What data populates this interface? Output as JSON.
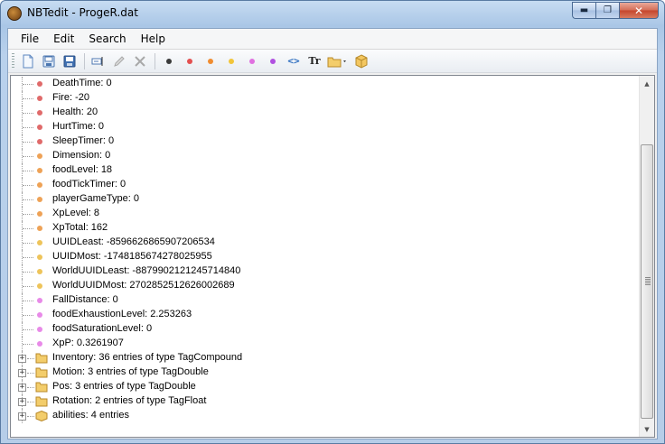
{
  "window": {
    "title": "NBTedit - ProgeR.dat"
  },
  "caption": {
    "minimize": "▬",
    "maximize": "❐",
    "close": "✕"
  },
  "menu": [
    {
      "label": "File"
    },
    {
      "label": "Edit"
    },
    {
      "label": "Search"
    },
    {
      "label": "Help"
    }
  ],
  "toolbar": {
    "icons": [
      "new-file-icon",
      "open-file-icon",
      "save-icon",
      "rename-icon",
      "edit-value-icon",
      "delete-icon"
    ],
    "tag_dots": [
      {
        "name": "byte-tag-icon",
        "color": "#3a3a3a"
      },
      {
        "name": "short-tag-icon",
        "color": "#e35050"
      },
      {
        "name": "int-tag-icon",
        "color": "#f08c30"
      },
      {
        "name": "long-tag-icon",
        "color": "#f2c53a"
      },
      {
        "name": "float-tag-icon",
        "color": "#e070e0"
      },
      {
        "name": "double-tag-icon",
        "color": "#b050e0"
      }
    ],
    "array_label": "<>",
    "string_label": "Tr"
  },
  "tree": {
    "rows": [
      {
        "label": "DeathTime: 0",
        "kind": "short",
        "color": "#e06a6a"
      },
      {
        "label": "Fire: -20",
        "kind": "short",
        "color": "#e06a6a"
      },
      {
        "label": "Health: 20",
        "kind": "short",
        "color": "#e06a6a"
      },
      {
        "label": "HurtTime: 0",
        "kind": "short",
        "color": "#e06a6a"
      },
      {
        "label": "SleepTimer: 0",
        "kind": "short",
        "color": "#e06a6a"
      },
      {
        "label": "Dimension: 0",
        "kind": "int",
        "color": "#eea256"
      },
      {
        "label": "foodLevel: 18",
        "kind": "int",
        "color": "#eea256"
      },
      {
        "label": "foodTickTimer: 0",
        "kind": "int",
        "color": "#eea256"
      },
      {
        "label": "playerGameType: 0",
        "kind": "int",
        "color": "#eea256"
      },
      {
        "label": "XpLevel: 8",
        "kind": "int",
        "color": "#eea256"
      },
      {
        "label": "XpTotal: 162",
        "kind": "int",
        "color": "#eea256"
      },
      {
        "label": "UUIDLeast: -8596626865907206534",
        "kind": "long",
        "color": "#eec45a"
      },
      {
        "label": "UUIDMost: -1748185674278025955",
        "kind": "long",
        "color": "#eec45a"
      },
      {
        "label": "WorldUUIDLeast: -8879902121245714840",
        "kind": "long",
        "color": "#eec45a"
      },
      {
        "label": "WorldUUIDMost: 2702852512626002689",
        "kind": "long",
        "color": "#eec45a"
      },
      {
        "label": "FallDistance: 0",
        "kind": "float",
        "color": "#e88ae8"
      },
      {
        "label": "foodExhaustionLevel: 2.253263",
        "kind": "float",
        "color": "#e88ae8"
      },
      {
        "label": "foodSaturationLevel: 0",
        "kind": "float",
        "color": "#e88ae8"
      },
      {
        "label": "XpP: 0.3261907",
        "kind": "float",
        "color": "#e88ae8"
      },
      {
        "label": "Inventory: 36 entries of type TagCompound",
        "kind": "list"
      },
      {
        "label": "Motion: 3 entries of type TagDouble",
        "kind": "list"
      },
      {
        "label": "Pos: 3 entries of type TagDouble",
        "kind": "list"
      },
      {
        "label": "Rotation: 2 entries of type TagFloat",
        "kind": "list"
      },
      {
        "label": "abilities: 4 entries",
        "kind": "compound"
      }
    ]
  },
  "scrollbar": {
    "up": "▲",
    "down": "▼"
  }
}
